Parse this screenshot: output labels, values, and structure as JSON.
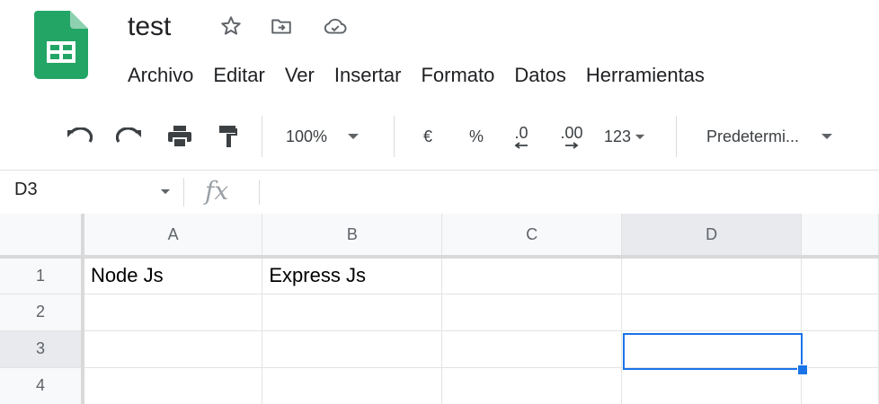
{
  "header": {
    "doc_title": "test",
    "icons": [
      "star-icon",
      "move-to-folder-icon",
      "cloud-saved-icon"
    ],
    "menu": [
      "Archivo",
      "Editar",
      "Ver",
      "Insertar",
      "Formato",
      "Datos",
      "Herramientas"
    ]
  },
  "toolbar": {
    "zoom": "100%",
    "currency": "€",
    "percent": "%",
    "decrease_decimals": ".0",
    "increase_decimals": ".00",
    "more_formats": "123",
    "font": "Predetermi...",
    "icons": [
      "undo-icon",
      "redo-icon",
      "print-icon",
      "paint-format-icon"
    ]
  },
  "formula_bar": {
    "name_box": "D3",
    "fx_label": "fx",
    "formula": ""
  },
  "grid": {
    "columns": [
      "A",
      "B",
      "C",
      "D"
    ],
    "rows": [
      "1",
      "2",
      "3",
      "4"
    ],
    "cells": [
      [
        "Node Js",
        "Express Js",
        "",
        ""
      ],
      [
        "",
        "",
        "",
        ""
      ],
      [
        "",
        "",
        "",
        ""
      ],
      [
        "",
        "",
        "",
        ""
      ]
    ],
    "selected_cell": "D3"
  },
  "colors": {
    "brand_green": "#23a566",
    "selection_blue": "#1a73e8"
  }
}
